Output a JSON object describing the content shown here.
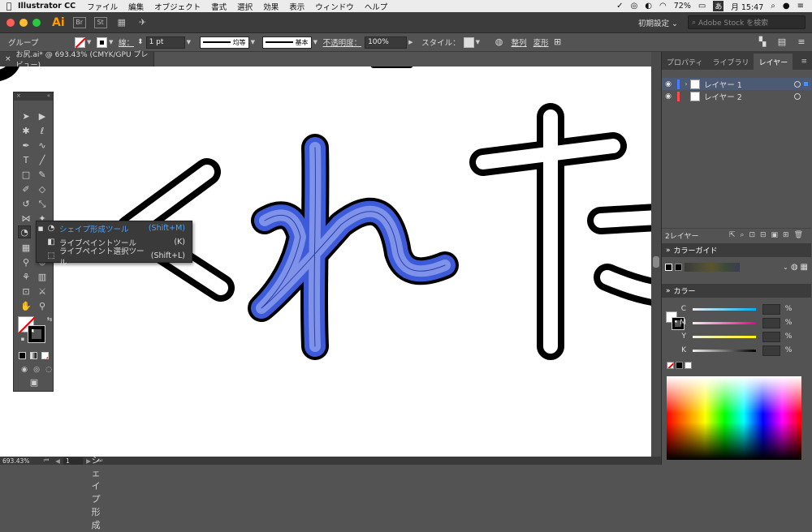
{
  "menubar": {
    "apple": "",
    "app": "Illustrator CC",
    "items": [
      "ファイル",
      "編集",
      "オブジェクト",
      "書式",
      "選択",
      "効果",
      "表示",
      "ウィンドウ",
      "ヘルプ"
    ],
    "battery": "72%",
    "ime": "あ",
    "clock": "月 15:47"
  },
  "appbar": {
    "logo": "Ai",
    "br": "Br",
    "st": "St",
    "workspace": "初期設定 ⌄",
    "search_placeholder": "Adobe Stock を検索"
  },
  "control": {
    "selection": "グループ",
    "stroke_label": "線：",
    "stroke_weight": "1 pt",
    "profile": "均等",
    "brush": "基本",
    "opacity_label": "不透明度：",
    "opacity": "100%",
    "style_label": "スタイル：",
    "align": "整列",
    "transform": "変形"
  },
  "document": {
    "tab": "お尻.ai* @ 693.43% (CMYK/GPU プレビュー)",
    "close": "×"
  },
  "status": {
    "zoom": "693.43%",
    "artboard": "1",
    "tool": "シェイプ形成"
  },
  "flyout": [
    {
      "label": "シェイプ形成ツール",
      "shortcut": "(Shift+M)"
    },
    {
      "label": "ライブペイントツール",
      "shortcut": "(K)"
    },
    {
      "label": "ライブペイント選択ツール",
      "shortcut": "(Shift+L)"
    }
  ],
  "panels": {
    "tabs": [
      "プロパティ",
      "ライブラリ",
      "レイヤー"
    ],
    "layers": [
      {
        "name": "レイヤー 1",
        "color": "#4b7bff"
      },
      {
        "name": "レイヤー 2",
        "color": "#ff4b4b"
      }
    ],
    "layer_count": "2レイヤー",
    "color_guide": "カラーガイド",
    "color": "カラー",
    "channels": [
      "C",
      "M",
      "Y",
      "K"
    ],
    "percent": "%"
  },
  "colors": {
    "accent": "#4ba3ff",
    "selection_blue": "#3d5bd8"
  }
}
